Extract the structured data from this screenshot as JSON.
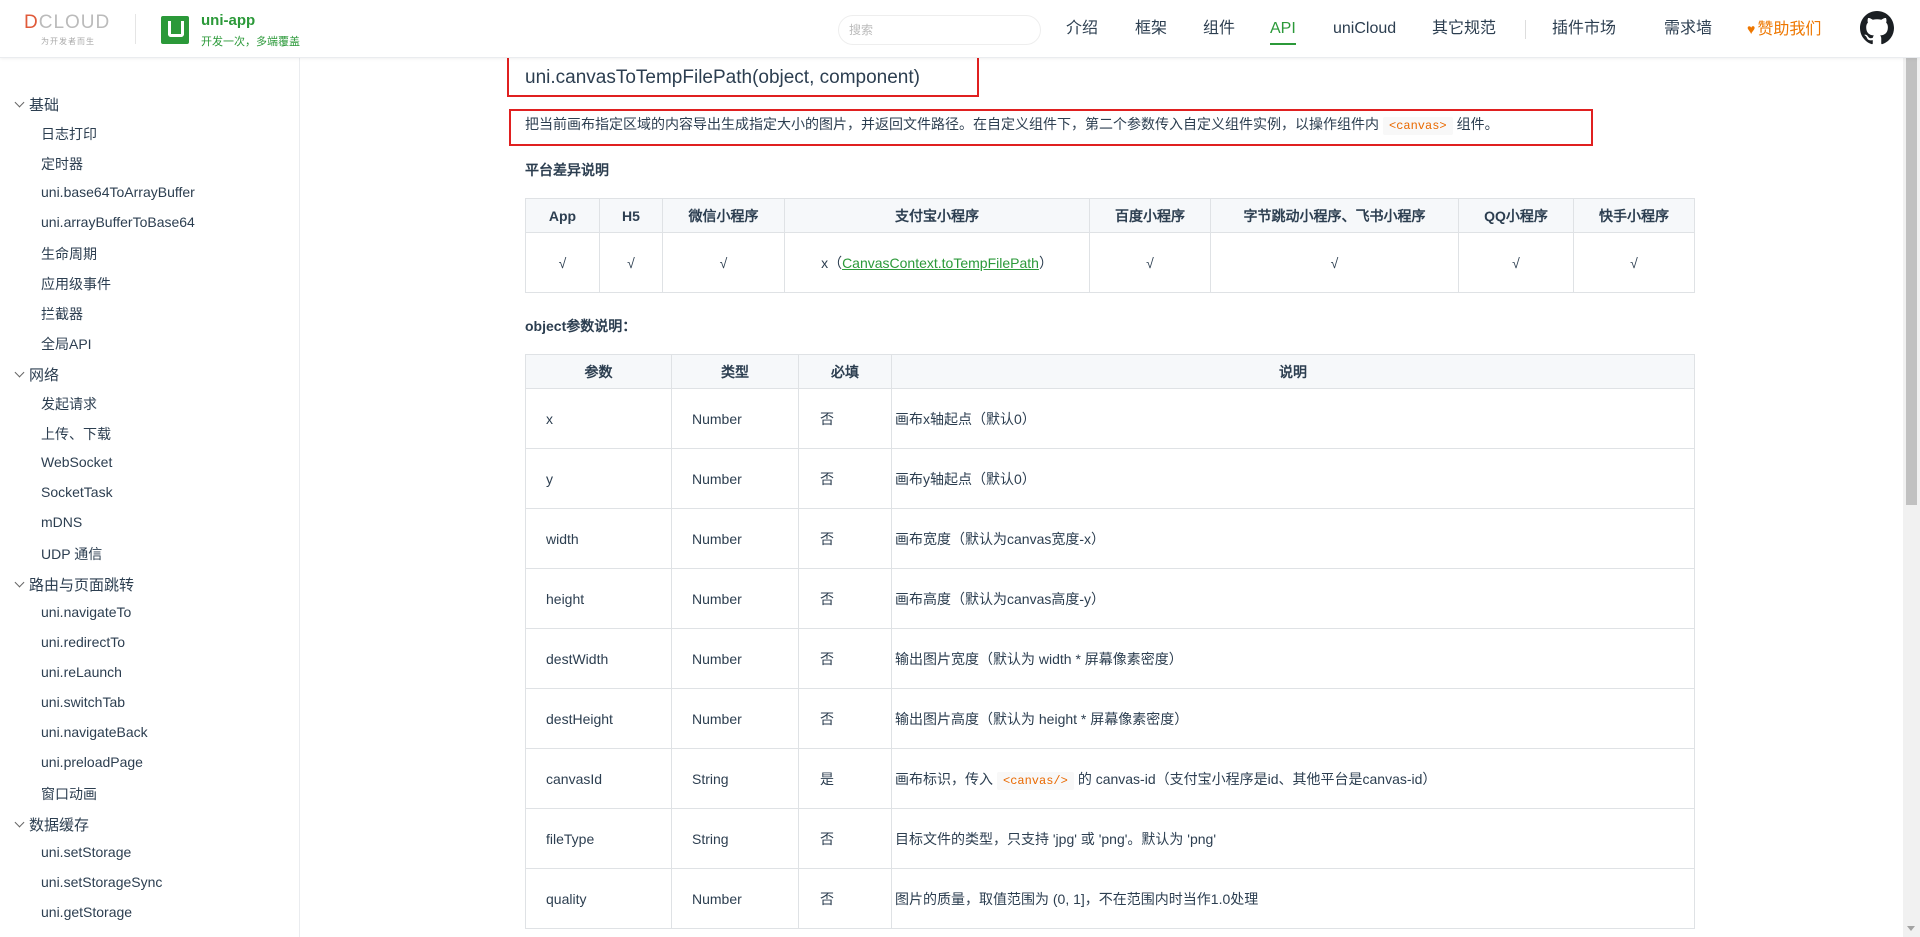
{
  "header": {
    "dcloud_brand_d": "D",
    "dcloud_brand_rest": "CLOUD",
    "dcloud_slogan": "为开发者而生",
    "uni_title": "uni-app",
    "uni_subtitle": "开发一次，多端覆盖",
    "search_placeholder": "搜索",
    "nav": [
      "介绍",
      "框架",
      "组件",
      "API",
      "uniCloud",
      "其它规范",
      "插件市场",
      "需求墙"
    ],
    "sponsor": "赞助我们"
  },
  "sidebar": {
    "groups": [
      {
        "label": "基础",
        "items": [
          "日志打印",
          "定时器",
          "uni.base64ToArrayBuffer",
          "uni.arrayBufferToBase64",
          "生命周期",
          "应用级事件",
          "拦截器",
          "全局API"
        ]
      },
      {
        "label": "网络",
        "items": [
          "发起请求",
          "上传、下载",
          "WebSocket",
          "SocketTask",
          "mDNS",
          "UDP 通信"
        ]
      },
      {
        "label": "路由与页面跳转",
        "items": [
          "uni.navigateTo",
          "uni.redirectTo",
          "uni.reLaunch",
          "uni.switchTab",
          "uni.navigateBack",
          "uni.preloadPage",
          "窗口动画"
        ]
      },
      {
        "label": "数据缓存",
        "items": [
          "uni.setStorage",
          "uni.setStorageSync",
          "uni.getStorage"
        ]
      }
    ]
  },
  "main": {
    "title": "uni.canvasToTempFilePath(object, component)",
    "desc_before": "把当前画布指定区域的内容导出生成指定大小的图片，并返回文件路径。在自定义组件下，第二个参数传入自定义组件实例，以操作组件内",
    "desc_code": "<canvas>",
    "desc_after": "组件。",
    "platform_heading": "平台差异说明",
    "platform_headers": [
      "App",
      "H5",
      "微信小程序",
      "支付宝小程序",
      "百度小程序",
      "字节跳动小程序、飞书小程序",
      "QQ小程序",
      "快手小程序"
    ],
    "platform_values": {
      "check": "√",
      "alipay_prefix": "x（",
      "alipay_link": "CanvasContext.toTempFilePath",
      "alipay_suffix": "）"
    },
    "object_heading": "object参数说明：",
    "param_headers": [
      "参数",
      "类型",
      "必填",
      "说明"
    ],
    "params": [
      {
        "name": "x",
        "type": "Number",
        "required": "否",
        "desc": "画布x轴起点（默认0）"
      },
      {
        "name": "y",
        "type": "Number",
        "required": "否",
        "desc": "画布y轴起点（默认0）"
      },
      {
        "name": "width",
        "type": "Number",
        "required": "否",
        "desc": "画布宽度（默认为canvas宽度-x）"
      },
      {
        "name": "height",
        "type": "Number",
        "required": "否",
        "desc": "画布高度（默认为canvas高度-y）"
      },
      {
        "name": "destWidth",
        "type": "Number",
        "required": "否",
        "desc": "输出图片宽度（默认为 width * 屏幕像素密度）"
      },
      {
        "name": "destHeight",
        "type": "Number",
        "required": "否",
        "desc": "输出图片高度（默认为 height * 屏幕像素密度）"
      },
      {
        "name": "canvasId",
        "type": "String",
        "required": "是",
        "desc_before": "画布标识，传入",
        "desc_code": "<canvas/>",
        "desc_after": "的 canvas-id（支付宝小程序是id、其他平台是canvas-id）"
      },
      {
        "name": "fileType",
        "type": "String",
        "required": "否",
        "desc": "目标文件的类型，只支持 'jpg' 或 'png'。默认为 'png'"
      },
      {
        "name": "quality",
        "type": "Number",
        "required": "否",
        "desc": "图片的质量，取值范围为 (0, 1]，不在范围内时当作1.0处理"
      }
    ]
  },
  "colors": {
    "brand_green": "#2b9939",
    "sponsor_orange": "#ee7700",
    "highlight_red": "#e02020"
  }
}
